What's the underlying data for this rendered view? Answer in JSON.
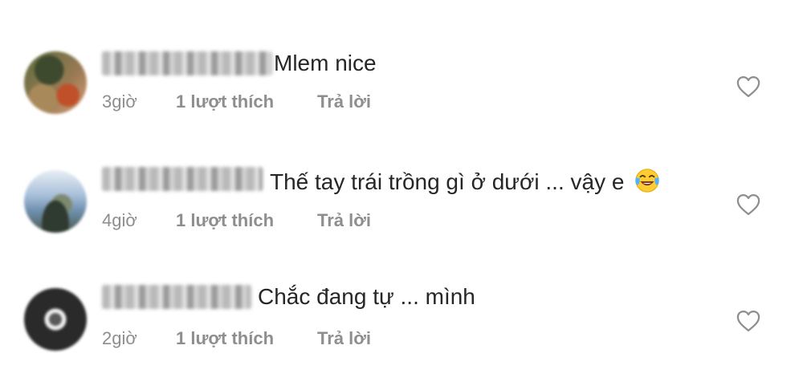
{
  "comments": [
    {
      "text": "Mlem nice",
      "time": "3giờ",
      "likes": "1 lượt thích",
      "reply": "Trả lời",
      "avatar_icon": "profile-photo"
    },
    {
      "text": "Thế tay trái trồng gì ở dưới ... vậy e",
      "emoji": "face-with-tears-of-joy-emoji",
      "time": "4giờ",
      "likes": "1 lượt thích",
      "reply": "Trả lời",
      "avatar_icon": "profile-photo"
    },
    {
      "text": "Chắc đang tự ... mình",
      "time": "2giờ",
      "likes": "1 lượt thích",
      "reply": "Trả lời",
      "avatar_icon": "profile-photo"
    }
  ],
  "colors": {
    "primary_text": "#262626",
    "secondary_text": "#8e8e8e",
    "background": "#ffffff",
    "heart_outline": "#8e8e8e"
  },
  "icons": {
    "like": "heart-outline-icon"
  }
}
